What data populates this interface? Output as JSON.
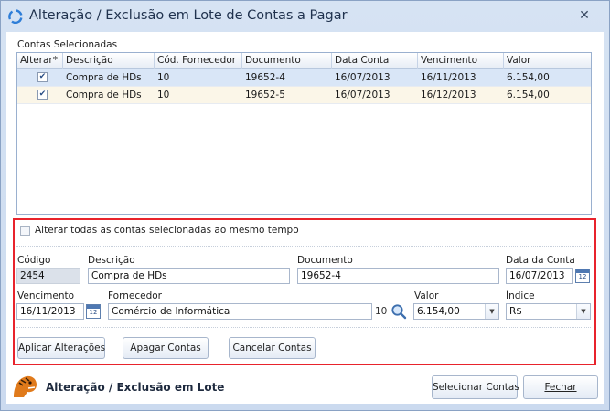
{
  "window": {
    "title": "Alteração / Exclusão em Lote de Contas a Pagar",
    "close_glyph": "✕"
  },
  "grid": {
    "section_label": "Contas Selecionadas",
    "columns": [
      "Alterar*",
      "Descrição",
      "Cód. Fornecedor",
      "Documento",
      "Data Conta",
      "Vencimento",
      "Valor"
    ],
    "rows": [
      {
        "alterar": true,
        "descricao": "Compra de HDs",
        "cod_fornecedor": "10",
        "documento": "19652-4",
        "data_conta": "16/07/2013",
        "vencimento": "16/11/2013",
        "valor": "6.154,00"
      },
      {
        "alterar": true,
        "descricao": "Compra de HDs",
        "cod_fornecedor": "10",
        "documento": "19652-5",
        "data_conta": "16/07/2013",
        "vencimento": "16/12/2013",
        "valor": "6.154,00"
      }
    ]
  },
  "edit": {
    "alter_all_label": "Alterar todas as contas selecionadas ao mesmo tempo",
    "codigo_label": "Código",
    "codigo_value": "2454",
    "descricao_label": "Descrição",
    "descricao_value": "Compra de HDs",
    "documento_label": "Documento",
    "documento_value": "19652-4",
    "data_conta_label": "Data da Conta",
    "data_conta_value": "16/07/2013",
    "vencimento_label": "Vencimento",
    "vencimento_value": "16/11/2013",
    "fornecedor_label": "Fornecedor",
    "fornecedor_value": "Comércio de Informática",
    "fornecedor_code": "10",
    "valor_label": "Valor",
    "valor_value": "6.154,00",
    "indice_label": "Índice",
    "indice_value": "R$",
    "calendar_day": "12"
  },
  "actions": {
    "aplicar": "Aplicar Alterações",
    "apagar": "Apagar Contas",
    "cancelar": "Cancelar Contas"
  },
  "footer": {
    "title": "Alteração / Exclusão em Lote",
    "selecionar": "Selecionar Contas",
    "fechar": "Fechar"
  },
  "colors": {
    "highlight_border": "#e8232c",
    "selected_row": "#d9e6f7",
    "window_bg": "#d6e3f3"
  },
  "icons": [
    "app-recycle-icon",
    "close-icon",
    "checkbox-checked-icon",
    "calendar-icon",
    "search-icon",
    "dropdown-arrow-icon",
    "tiger-logo-icon"
  ]
}
